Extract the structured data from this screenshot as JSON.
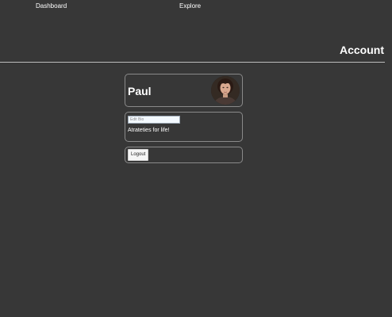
{
  "nav": {
    "dashboard_label": "Dashboard",
    "explore_label": "Explore"
  },
  "header": {
    "title": "Account"
  },
  "profile": {
    "name": "Paul",
    "avatar_icon": "user-avatar-photo"
  },
  "bio": {
    "input_placeholder": "Edit Bio",
    "input_value": "",
    "text": "Atrateties for life!"
  },
  "actions": {
    "logout_label": "Logout"
  },
  "colors": {
    "background": "#373737",
    "text": "#ffffff",
    "border": "#8a8a8a",
    "divider": "#bdbdbd"
  }
}
